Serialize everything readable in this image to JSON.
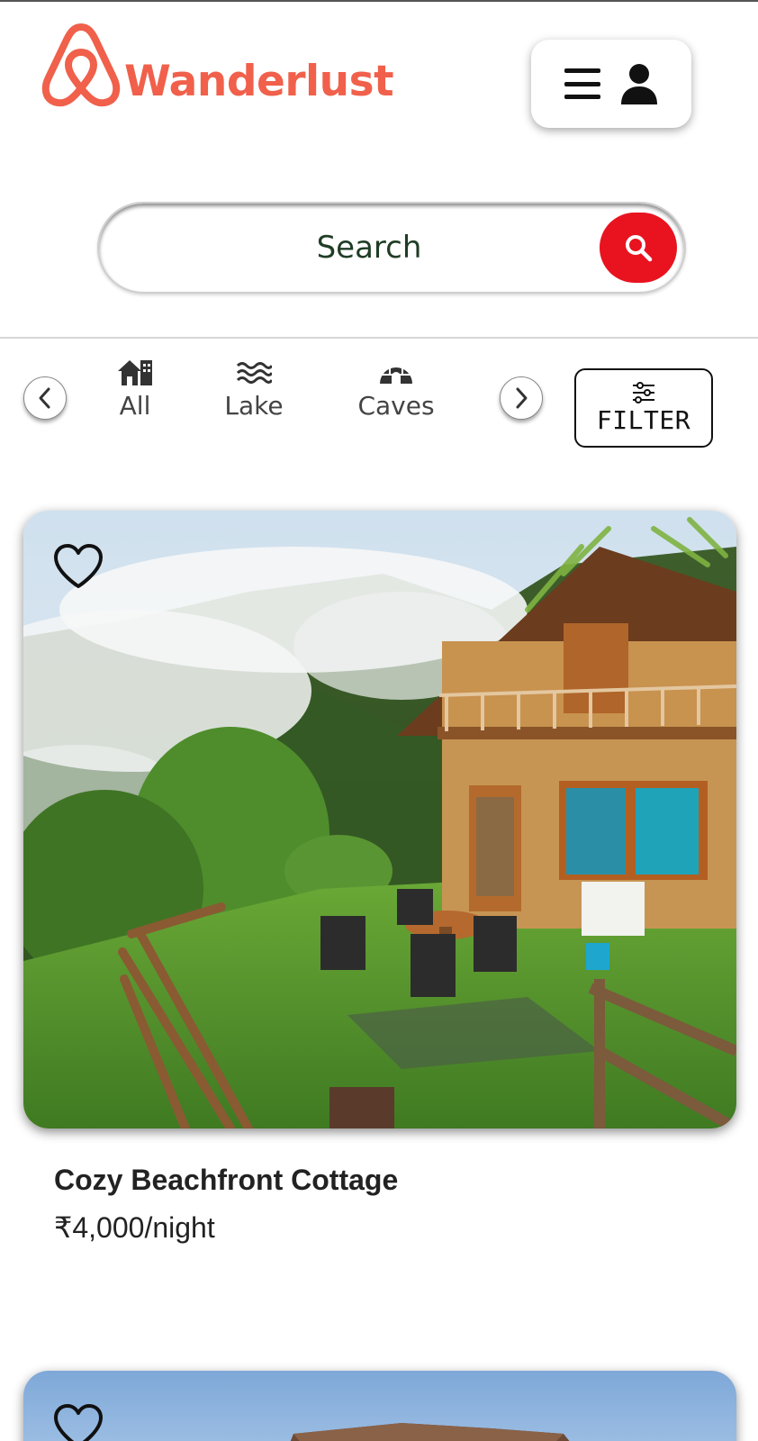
{
  "brand": {
    "name": "Wanderlust",
    "logo_icon": "airbnb-loop-icon",
    "color": "#f0604b"
  },
  "header": {
    "menu_icon": "hamburger-menu-icon",
    "user_icon": "user-icon"
  },
  "search": {
    "placeholder": "Search",
    "button_icon": "search-icon",
    "button_color": "#e8131f"
  },
  "categories": {
    "prev_icon": "chevron-left-icon",
    "next_icon": "chevron-right-icon",
    "items": [
      {
        "label": "All",
        "icon": "houses-icon"
      },
      {
        "label": "Lake",
        "icon": "water-waves-icon"
      },
      {
        "label": "Caves",
        "icon": "igloo-icon"
      }
    ],
    "filter": {
      "label": "FILTER",
      "icon": "sliders-icon"
    }
  },
  "listings": [
    {
      "title": "Cozy Beachfront Cottage",
      "price": "₹4,000/night",
      "favorite_icon": "heart-outline-icon",
      "image": "mountain cottage in misty forest"
    },
    {
      "title": "",
      "price": "",
      "favorite_icon": "heart-outline-icon",
      "image": "rocky mountain under blue sky"
    }
  ]
}
